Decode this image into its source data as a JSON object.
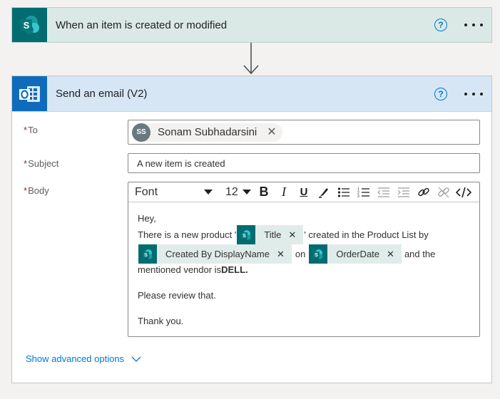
{
  "trigger": {
    "title": "When an item is created or modified",
    "icon": "sharepoint-icon",
    "help_symbol": "?",
    "accent": "#036c70"
  },
  "action": {
    "title": "Send an email (V2)",
    "icon": "outlook-icon",
    "help_symbol": "?",
    "accent": "#0f6cbd"
  },
  "fields": {
    "required_mark": "*",
    "to_label": "To",
    "to_recipient": {
      "initials": "SS",
      "name": "Sonam Subhadarsini",
      "remove": "✕"
    },
    "subject_label": "Subject",
    "subject_value": "A new item is created",
    "body_label": "Body"
  },
  "toolbar": {
    "font": "Font",
    "size": "12",
    "bold": "B",
    "italic": "I",
    "underline": "U"
  },
  "body": {
    "greeting": "Hey,",
    "line1_prefix": "There is a new product '",
    "token_title": "Title",
    "line1_suffix": "' created in the Product List by",
    "token_created_by": "Created By DisplayName",
    "connector_on": "on",
    "token_order_date": "OrderDate",
    "connector_and": "and the",
    "line3_prefix": "mentioned vendor is ",
    "vendor": "DELL.",
    "review": "Please review that.",
    "thanks": "Thank you.",
    "token_remove": "✕"
  },
  "advanced_options": "Show advanced options"
}
